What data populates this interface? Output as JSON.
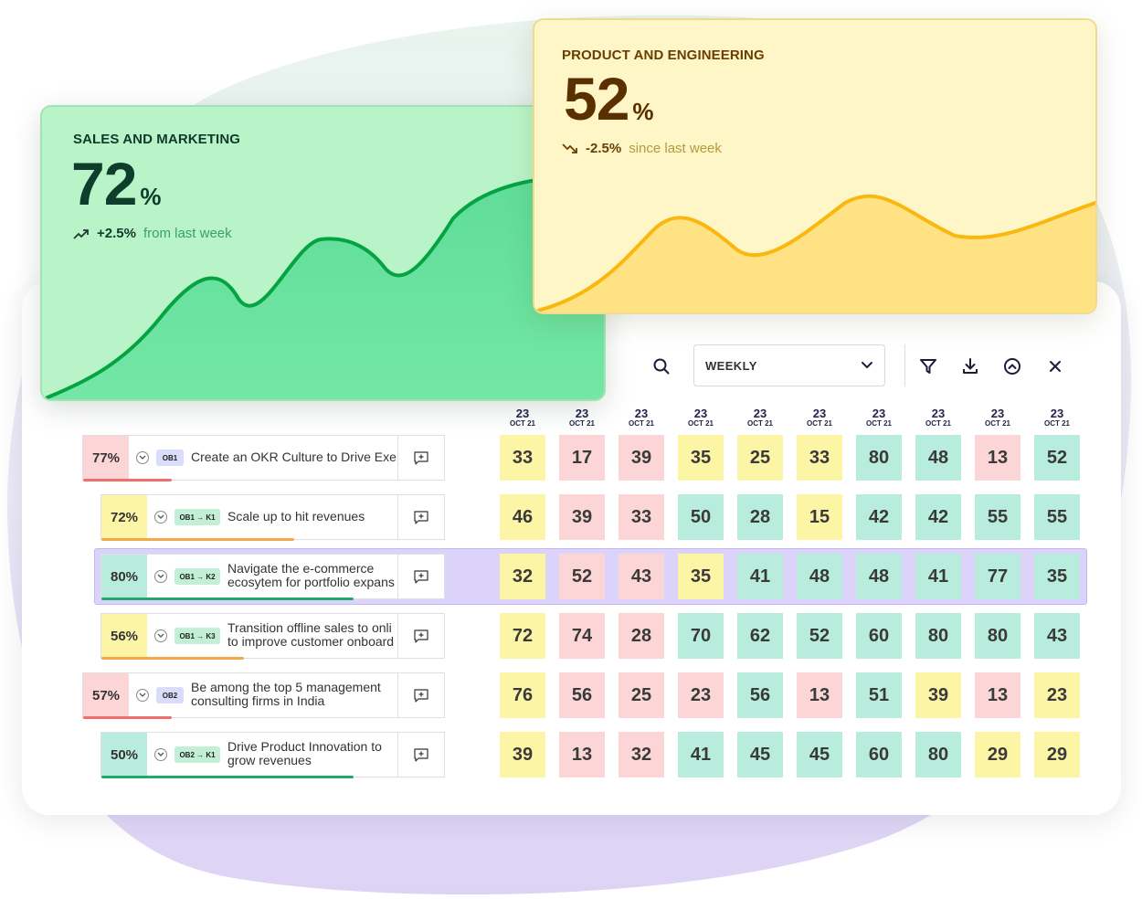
{
  "colors": {
    "red_cell": "#fcd6d6",
    "yellow_cell": "#fdf5a6",
    "green_cell": "#b8ecdc",
    "red_bar": "#f26d6d",
    "yellow_bar": "#f4a84a",
    "green_bar": "#21a86b",
    "highlight": "#dcd3fa"
  },
  "sales": {
    "title": "SALES AND MARKETING",
    "value": "72",
    "unit": "%",
    "delta": "+2.5%",
    "delta_text": "from last week",
    "trend_icon": "trend-up-icon"
  },
  "product": {
    "title": "PRODUCT AND ENGINEERING",
    "value": "52",
    "unit": "%",
    "delta": "-2.5%",
    "delta_text": "since last week",
    "trend_icon": "trend-down-icon"
  },
  "toolbar": {
    "period": "WEEKLY",
    "icons": [
      "search-icon",
      "chevron-down-icon",
      "filter-icon",
      "download-icon",
      "collapse-icon",
      "close-icon"
    ]
  },
  "dates": [
    {
      "day": "23",
      "month": "OCT 21"
    },
    {
      "day": "23",
      "month": "OCT 21"
    },
    {
      "day": "23",
      "month": "OCT 21"
    },
    {
      "day": "23",
      "month": "OCT 21"
    },
    {
      "day": "23",
      "month": "OCT 21"
    },
    {
      "day": "23",
      "month": "OCT 21"
    },
    {
      "day": "23",
      "month": "OCT 21"
    },
    {
      "day": "23",
      "month": "OCT 21"
    },
    {
      "day": "23",
      "month": "OCT 21"
    },
    {
      "day": "23",
      "month": "OCT 21"
    }
  ],
  "rows": [
    {
      "percent": "77%",
      "progress": 0.28,
      "status": "red",
      "badge": "OB1",
      "title_lines": [
        "Create an OKR Culture to Drive Exe"
      ],
      "highlighted": false,
      "values": [
        "33",
        "17",
        "39",
        "35",
        "25",
        "33",
        "80",
        "48",
        "13",
        "52"
      ],
      "status_cells": [
        "yellow",
        "red",
        "red",
        "yellow",
        "yellow",
        "yellow",
        "green",
        "green",
        "red",
        "green"
      ]
    },
    {
      "percent": "72%",
      "progress": 0.65,
      "status": "yellow",
      "badge": "OB1 → K1",
      "title_lines": [
        "Scale up to hit revenues"
      ],
      "highlighted": false,
      "values": [
        "46",
        "39",
        "33",
        "50",
        "28",
        "15",
        "42",
        "42",
        "55",
        "55"
      ],
      "status_cells": [
        "yellow",
        "red",
        "red",
        "green",
        "green",
        "yellow",
        "green",
        "green",
        "green",
        "green"
      ]
    },
    {
      "percent": "80%",
      "progress": 0.85,
      "status": "green",
      "badge": "OB1 → K2",
      "title_lines": [
        "Navigate the e-commerce",
        "ecosytem for portfolio expans"
      ],
      "highlighted": true,
      "values": [
        "32",
        "52",
        "43",
        "35",
        "41",
        "48",
        "48",
        "41",
        "77",
        "35"
      ],
      "status_cells": [
        "yellow",
        "red",
        "red",
        "yellow",
        "green",
        "green",
        "green",
        "green",
        "green",
        "green"
      ]
    },
    {
      "percent": "56%",
      "progress": 0.48,
      "status": "yellow",
      "badge": "OB1 → K3",
      "title_lines": [
        "Transition offline sales to onli",
        "to improve customer onboard"
      ],
      "highlighted": false,
      "values": [
        "72",
        "74",
        "28",
        "70",
        "62",
        "52",
        "60",
        "80",
        "80",
        "43"
      ],
      "status_cells": [
        "yellow",
        "red",
        "red",
        "green",
        "green",
        "green",
        "green",
        "green",
        "green",
        "green"
      ]
    },
    {
      "percent": "57%",
      "progress": 0.28,
      "status": "red",
      "badge": "OB2",
      "title_lines": [
        "Be among the top 5 management",
        "consulting firms in India"
      ],
      "highlighted": false,
      "values": [
        "76",
        "56",
        "25",
        "23",
        "56",
        "13",
        "51",
        "39",
        "13",
        "23"
      ],
      "status_cells": [
        "yellow",
        "red",
        "red",
        "red",
        "green",
        "red",
        "green",
        "yellow",
        "red",
        "yellow"
      ]
    },
    {
      "percent": "50%",
      "progress": 0.85,
      "status": "green",
      "badge": "OB2 → K1",
      "title_lines": [
        "Drive Product Innovation to",
        "grow revenues"
      ],
      "highlighted": false,
      "values": [
        "39",
        "13",
        "32",
        "41",
        "45",
        "45",
        "60",
        "80",
        "29",
        "29"
      ],
      "status_cells": [
        "yellow",
        "red",
        "red",
        "green",
        "green",
        "green",
        "green",
        "green",
        "yellow",
        "yellow"
      ]
    }
  ]
}
